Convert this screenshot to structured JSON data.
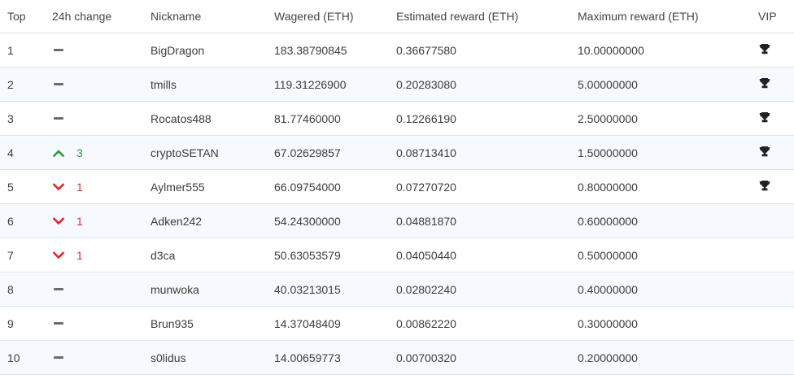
{
  "columns": {
    "top": "Top",
    "change": "24h change",
    "nickname": "Nickname",
    "wagered": "Wagered (ETH)",
    "estimated": "Estimated reward (ETH)",
    "maximum": "Maximum reward (ETH)",
    "vip": "VIP"
  },
  "colors": {
    "up": "#2a9d3a",
    "down": "#e0282e",
    "dash": "#6b6b6b"
  },
  "rows": [
    {
      "rank": "1",
      "change_dir": "none",
      "change": "",
      "nickname": "BigDragon",
      "wagered": "183.38790845",
      "estimated": "0.36677580",
      "maximum": "10.00000000",
      "vip": "trophy-icon"
    },
    {
      "rank": "2",
      "change_dir": "none",
      "change": "",
      "nickname": "tmills",
      "wagered": "119.31226900",
      "estimated": "0.20283080",
      "maximum": "5.00000000",
      "vip": "trophy-icon"
    },
    {
      "rank": "3",
      "change_dir": "none",
      "change": "",
      "nickname": "Rocatos488",
      "wagered": "81.77460000",
      "estimated": "0.12266190",
      "maximum": "2.50000000",
      "vip": "trophy-icon"
    },
    {
      "rank": "4",
      "change_dir": "up",
      "change": "3",
      "nickname": "cryptoSETAN",
      "wagered": "67.02629857",
      "estimated": "0.08713410",
      "maximum": "1.50000000",
      "vip": "trophy-icon"
    },
    {
      "rank": "5",
      "change_dir": "down",
      "change": "1",
      "nickname": "Aylmer555",
      "wagered": "66.09754000",
      "estimated": "0.07270720",
      "maximum": "0.80000000",
      "vip": "trophy-icon"
    },
    {
      "rank": "6",
      "change_dir": "down",
      "change": "1",
      "nickname": "Adken242",
      "wagered": "54.24300000",
      "estimated": "0.04881870",
      "maximum": "0.60000000",
      "vip": ""
    },
    {
      "rank": "7",
      "change_dir": "down",
      "change": "1",
      "nickname": "d3ca",
      "wagered": "50.63053579",
      "estimated": "0.04050440",
      "maximum": "0.50000000",
      "vip": ""
    },
    {
      "rank": "8",
      "change_dir": "none",
      "change": "",
      "nickname": "munwoka",
      "wagered": "40.03213015",
      "estimated": "0.02802240",
      "maximum": "0.40000000",
      "vip": ""
    },
    {
      "rank": "9",
      "change_dir": "none",
      "change": "",
      "nickname": "Brun935",
      "wagered": "14.37048409",
      "estimated": "0.00862220",
      "maximum": "0.30000000",
      "vip": ""
    },
    {
      "rank": "10",
      "change_dir": "none",
      "change": "",
      "nickname": "s0lidus",
      "wagered": "14.00659773",
      "estimated": "0.00700320",
      "maximum": "0.20000000",
      "vip": ""
    }
  ]
}
